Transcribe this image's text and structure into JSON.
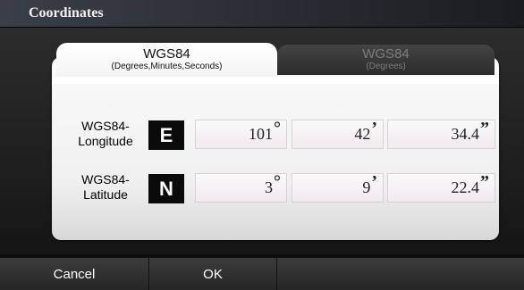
{
  "window": {
    "title": "Coordinates"
  },
  "tabs": [
    {
      "label": "WGS84",
      "sublabel": "(Degrees,Minutes,Seconds)",
      "active": true
    },
    {
      "label": "WGS84",
      "sublabel": "(Degrees)",
      "active": false
    }
  ],
  "rows": [
    {
      "label_line1": "WGS84-",
      "label_line2": "Longitude",
      "direction": "E",
      "degrees": "101",
      "minutes": "42",
      "seconds": "34.4"
    },
    {
      "label_line1": "WGS84-",
      "label_line2": "Latitude",
      "direction": "N",
      "degrees": "3",
      "minutes": "9",
      "seconds": "22.4"
    }
  ],
  "symbols": {
    "degree": "°",
    "minute": "’",
    "second": "”"
  },
  "buttons": {
    "cancel": "Cancel",
    "ok": "OK"
  }
}
